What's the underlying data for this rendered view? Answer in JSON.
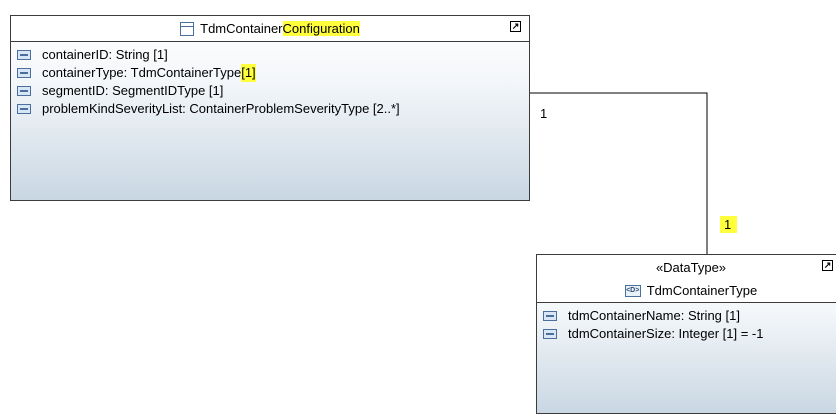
{
  "config_class": {
    "title_prefix": "TdmContainer",
    "title_highlight": "Configuration",
    "expand_glyph": "↗",
    "attributes": [
      {
        "text": "containerID: String [1]",
        "highlight": ""
      },
      {
        "text": "containerType: TdmContainerType ",
        "highlight": "[1]"
      },
      {
        "text": "segmentID: SegmentIDType [1]",
        "highlight": ""
      },
      {
        "text": "problemKindSeverityList: ContainerProblemSeverityType [2..*]",
        "highlight": ""
      }
    ]
  },
  "datatype_class": {
    "stereotype": "«DataType»",
    "icon_text": "<D>",
    "title": "TdmContainerType",
    "expand_glyph": "↗",
    "attributes": [
      {
        "text": "tdmContainerName: String [1]"
      },
      {
        "text": "tdmContainerSize: Integer [1] = -1"
      }
    ]
  },
  "association": {
    "source_multiplicity": "1",
    "target_multiplicity": "1"
  },
  "colors": {
    "highlight": "#ffff3c",
    "border": "#3c3c3c",
    "gradient_bottom": "#c9d7e3",
    "icon_blue": "#4a6f9c"
  },
  "icons": [
    "class-icon",
    "attribute-icon",
    "datatype-icon",
    "expand-icon"
  ]
}
